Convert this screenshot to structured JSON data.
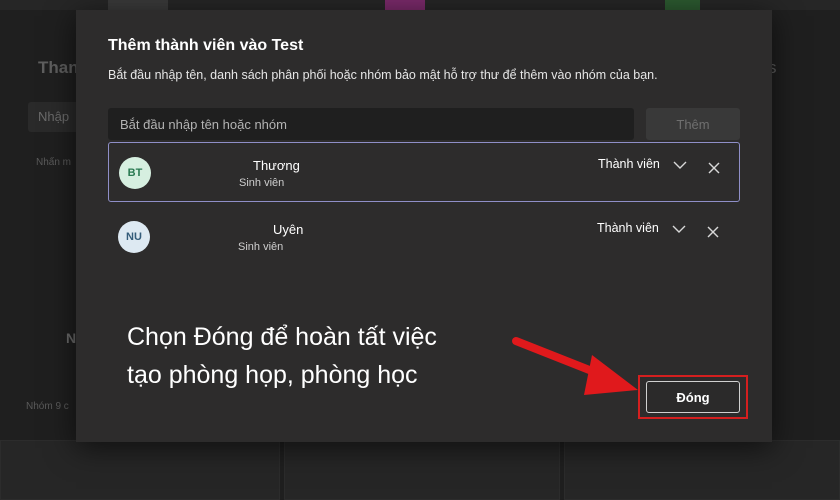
{
  "background": {
    "title": "Thanh",
    "title_right": "s",
    "input_placeholder": "Nhập",
    "hint": "Nhấn m",
    "section_letter": "N",
    "group_text": "Nhóm 9 c"
  },
  "dialog": {
    "title": "Thêm thành viên vào Test",
    "description": "Bắt đầu nhập tên, danh sách phân phối hoặc nhóm bảo mật hỗ trợ thư để thêm vào nhóm của bạn.",
    "search": {
      "placeholder": "Bắt đầu nhập tên hoặc nhóm",
      "value": ""
    },
    "add_button": "Thêm",
    "members": [
      {
        "initials": "BT",
        "name": "Thương",
        "subtitle": "Sinh viên",
        "role": "Thành viên",
        "icon": "chevron-down-icon",
        "remove_icon": "close-icon"
      },
      {
        "initials": "NU",
        "name": "Uyên",
        "subtitle": "Sinh viên",
        "role": "Thành viên",
        "icon": "chevron-down-icon",
        "remove_icon": "close-icon"
      }
    ],
    "close_button": "Đóng"
  },
  "annotation": {
    "line1": "Chọn Đóng để hoàn tất việc",
    "line2": "tạo phòng họp, phòng học",
    "arrow_icon": "arrow-right-icon"
  },
  "colors": {
    "highlight_red": "#d51f1f",
    "selected_border": "#8f8fc8",
    "dialog_bg": "#2d2c2c"
  }
}
